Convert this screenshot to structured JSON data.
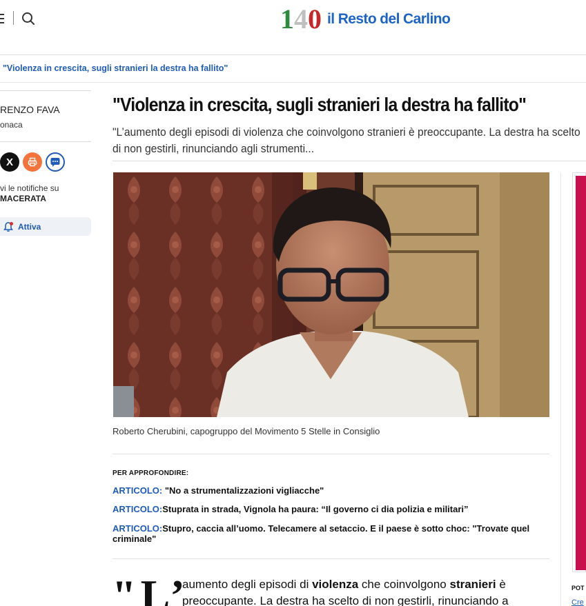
{
  "header": {
    "logo_number": [
      "1",
      "4",
      "0"
    ],
    "logo_text": "il Resto del Carlino"
  },
  "breadcrumb": {
    "current": "\"Violenza in crescita, sugli stranieri la destra ha fallito\""
  },
  "sidebar": {
    "author": "RENZO FAVA",
    "category": "onaca",
    "share_x_label": "X",
    "notifications_text": "vi le notifiche su",
    "notifications_city": "MACERATA",
    "activate_label": "Attiva"
  },
  "article": {
    "headline": "\"Violenza in crescita, sugli stranieri la destra ha fallito\"",
    "subtitle": "\"L’aumento degli episodi di violenza che coinvolgono stranieri è preoccupante. La destra ha scelto di non gestirli, rinunciando agli strumenti...",
    "photo_caption": "Roberto Cherubini, capogruppo del Movimento 5 Stelle in Consiglio",
    "related_title": "PER APPROFONDIRE:",
    "related": [
      {
        "kind": "ARTICOLO:",
        "title": "\"No a strumentalizzazioni vigliacche\""
      },
      {
        "kind": "ARTICOLO:",
        "title": "Stuprata in strada, Vignola ha paura: “Il governo ci dia polizia e militari”"
      },
      {
        "kind": "ARTICOLO:",
        "title": "Stupro, caccia all’uomo. Telecamere al setaccio. E il paese è sotto choc: \"Trovate quel criminale\""
      }
    ],
    "dropcap": "\"L’",
    "body": {
      "p1_a": "aumento degli episodi di ",
      "p1_b": "violenza",
      "p1_c": " che coinvolgono ",
      "p1_d": "stranieri",
      "p1_e": " è preoccupante. La destra ha scelto di non gestirli, rinunciando a"
    }
  },
  "right_rail": {
    "powered_label": "POT",
    "powered_link": "Cre"
  },
  "colors": {
    "brand_blue": "#1c64c8",
    "link_blue": "#1f5bb8",
    "logo_green": "#2e8b3d",
    "logo_red": "#c62828",
    "ad_magenta": "#c8104f",
    "share_orange": "#f4743b"
  }
}
